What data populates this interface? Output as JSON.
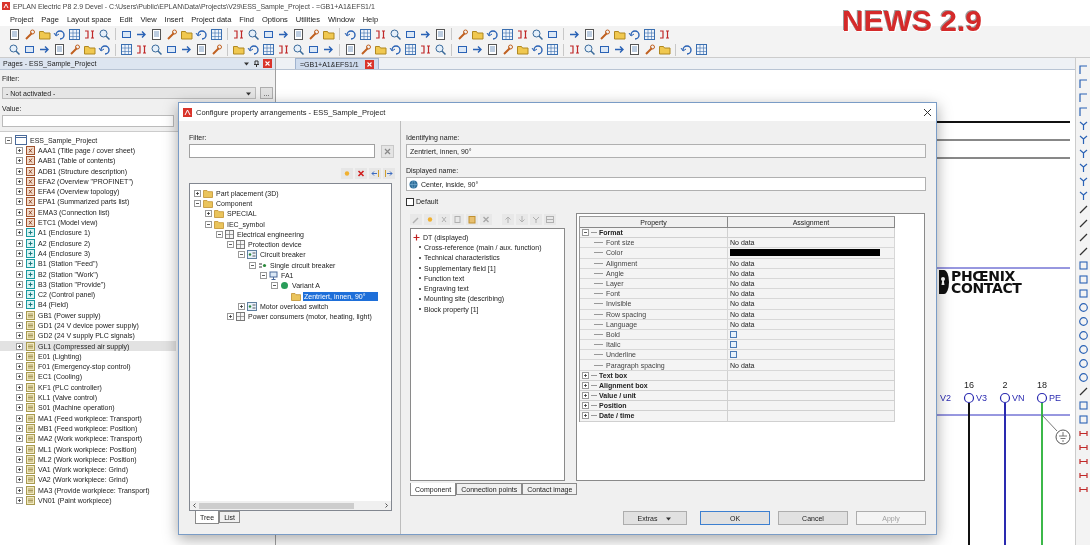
{
  "window": {
    "title": "EPLAN Electric P8 2.9 Devel - C:\\Users\\Public\\EPLAN\\Data\\Projects\\V29\\ESS_Sample_Project - =GB1+A1&EFS1/1"
  },
  "menu": [
    "Project",
    "Page",
    "Layout space",
    "Edit",
    "View",
    "Insert",
    "Project data",
    "Find",
    "Options",
    "Utilities",
    "Window",
    "Help"
  ],
  "overlay_title": "NEWS 2.9",
  "pages_panel": {
    "title": "Pages - ESS_Sample_Project",
    "filter_label": "Filter:",
    "filter_value": "- Not activated -",
    "browse_button": "...",
    "value_label": "Value:",
    "tree": {
      "label": "ESS_Sample_Project",
      "kind": "project",
      "expanded": true,
      "selected": false,
      "children": [
        {
          "label": "AAA1 (Title page / cover sheet)",
          "kind": "document",
          "expanded": false,
          "selected": false
        },
        {
          "label": "AAB1 (Table of contents)",
          "kind": "document",
          "expanded": false,
          "selected": false
        },
        {
          "label": "ADB1 (Structure description)",
          "kind": "document",
          "expanded": false,
          "selected": false
        },
        {
          "label": "EFA2 (Overview \"PROFINET\")",
          "kind": "document",
          "expanded": false,
          "selected": false
        },
        {
          "label": "EFA4 (Overview topology)",
          "kind": "document",
          "expanded": false,
          "selected": false
        },
        {
          "label": "EPA1 (Summarized parts list)",
          "kind": "document",
          "expanded": false,
          "selected": false
        },
        {
          "label": "EMA3 (Connection list)",
          "kind": "document",
          "expanded": false,
          "selected": false
        },
        {
          "label": "ETC1 (Model view)",
          "kind": "document",
          "expanded": false,
          "selected": false
        },
        {
          "label": "A1 (Enclosure 1)",
          "kind": "enclosure",
          "expanded": false,
          "selected": false
        },
        {
          "label": "A2 (Enclosure 2)",
          "kind": "enclosure",
          "expanded": false,
          "selected": false
        },
        {
          "label": "A4 (Enclosure 3)",
          "kind": "enclosure",
          "expanded": false,
          "selected": false
        },
        {
          "label": "B1 (Station \"Feed\")",
          "kind": "enclosure",
          "expanded": false,
          "selected": false
        },
        {
          "label": "B2 (Station \"Work\")",
          "kind": "enclosure",
          "expanded": false,
          "selected": false
        },
        {
          "label": "B3 (Station \"Provide\")",
          "kind": "enclosure",
          "expanded": false,
          "selected": false
        },
        {
          "label": "C2 (Control panel)",
          "kind": "enclosure",
          "expanded": false,
          "selected": false
        },
        {
          "label": "B4 (Field)",
          "kind": "enclosure",
          "expanded": false,
          "selected": false
        },
        {
          "label": "GB1 (Power supply)",
          "kind": "function",
          "expanded": false,
          "selected": false
        },
        {
          "label": "GD1 (24 V device power supply)",
          "kind": "function",
          "expanded": false,
          "selected": false
        },
        {
          "label": "GD2 (24 V supply PLC signals)",
          "kind": "function",
          "expanded": false,
          "selected": false
        },
        {
          "label": "GL1 (Compressed air supply)",
          "kind": "function",
          "expanded": false,
          "selected": true
        },
        {
          "label": "E01 (Lighting)",
          "kind": "function",
          "expanded": false,
          "selected": false
        },
        {
          "label": "F01 (Emergency-stop control)",
          "kind": "function",
          "expanded": false,
          "selected": false
        },
        {
          "label": "EC1 (Cooling)",
          "kind": "function",
          "expanded": false,
          "selected": false
        },
        {
          "label": "KF1 (PLC controller)",
          "kind": "function",
          "expanded": false,
          "selected": false
        },
        {
          "label": "KL1 (Valve control)",
          "kind": "function",
          "expanded": false,
          "selected": false
        },
        {
          "label": "S01 (Machine operation)",
          "kind": "function",
          "expanded": false,
          "selected": false
        },
        {
          "label": "MA1 (Feed workpiece: Transport)",
          "kind": "function",
          "expanded": false,
          "selected": false
        },
        {
          "label": "MB1 (Feed workpiece: Position)",
          "kind": "function",
          "expanded": false,
          "selected": false
        },
        {
          "label": "MA2 (Work workpiece: Transport)",
          "kind": "function",
          "expanded": false,
          "selected": false
        },
        {
          "label": "ML1 (Work workpiece: Position)",
          "kind": "function",
          "expanded": false,
          "selected": false
        },
        {
          "label": "ML2 (Work workpiece: Position)",
          "kind": "function",
          "expanded": false,
          "selected": false
        },
        {
          "label": "VA1 (Work workpiece: Grind)",
          "kind": "function",
          "expanded": false,
          "selected": false
        },
        {
          "label": "VA2 (Work workpiece: Grind)",
          "kind": "function",
          "expanded": false,
          "selected": false
        },
        {
          "label": "MA3 (Provide workpiece: Transport)",
          "kind": "function",
          "expanded": false,
          "selected": false
        },
        {
          "label": "VN01 (Paint workpiece)",
          "kind": "function",
          "expanded": false,
          "selected": false
        }
      ]
    }
  },
  "document_tab": {
    "label": "=GB1+A1&EFS1/1"
  },
  "schematic": {
    "logo": [
      "PHŒNIX",
      "CONTACT"
    ],
    "terminals": [
      {
        "label": "V2"
      },
      {
        "number": "16",
        "label": "V3",
        "color": "#111111"
      },
      {
        "number": "2",
        "label": "VN",
        "color": "#2a2ab0"
      },
      {
        "number": "18",
        "label": "PE",
        "color": "#3cb84a"
      }
    ]
  },
  "dialog": {
    "title": "Configure property arrangements - ESS_Sample_Project",
    "filter_label": "Filter:",
    "tree": [
      {
        "label": "Part placement (3D)",
        "kind": "folder",
        "expanded": false,
        "selected": false
      },
      {
        "label": "Component",
        "kind": "folder",
        "expanded": true,
        "selected": false,
        "children": [
          {
            "label": "SPECIAL",
            "kind": "folder",
            "expanded": false,
            "selected": false
          },
          {
            "label": "IEC_symbol",
            "kind": "folder",
            "expanded": true,
            "selected": false,
            "children": [
              {
                "label": "Electrical engineering",
                "kind": "category",
                "expanded": true,
                "selected": false,
                "children": [
                  {
                    "label": "Protection device",
                    "kind": "category",
                    "expanded": true,
                    "selected": false,
                    "children": [
                      {
                        "label": "Circuit breaker",
                        "kind": "symbol",
                        "expanded": true,
                        "selected": false,
                        "children": [
                          {
                            "label": "Single circuit breaker",
                            "kind": "contacts",
                            "expanded": true,
                            "selected": false,
                            "children": [
                              {
                                "label": "FA1",
                                "kind": "device",
                                "expanded": true,
                                "selected": false,
                                "children": [
                                  {
                                    "label": "Variant A",
                                    "kind": "variant",
                                    "expanded": true,
                                    "selected": false,
                                    "children": [
                                      {
                                        "label": "Zentriert, innen, 90°",
                                        "kind": "folder",
                                        "selected": true
                                      }
                                    ]
                                  }
                                ]
                              }
                            ]
                          }
                        ]
                      },
                      {
                        "label": "Motor overload switch",
                        "kind": "symbol",
                        "expanded": false,
                        "selected": false
                      }
                    ]
                  },
                  {
                    "label": "Power consumers (motor, heating, light)",
                    "kind": "category",
                    "expanded": false,
                    "selected": false
                  }
                ]
              }
            ]
          }
        ]
      }
    ],
    "tabs": [
      {
        "label": "Tree",
        "selected": true
      },
      {
        "label": "List",
        "selected": false
      }
    ],
    "identifying_name": {
      "label": "Identifying name:",
      "value": "Zentriert, innen, 90°"
    },
    "displayed_name": {
      "label": "Displayed name:",
      "value": "Center, inside, 90°"
    },
    "default": {
      "label": "Default",
      "checked": false
    },
    "arrangement_list": [
      {
        "label": "DT (displayed)",
        "kind": "main"
      },
      {
        "label": "Cross-reference (main / aux. function)",
        "kind": "item"
      },
      {
        "label": "Technical characteristics",
        "kind": "item"
      },
      {
        "label": "Supplementary field [1]",
        "kind": "item"
      },
      {
        "label": "Function text",
        "kind": "item"
      },
      {
        "label": "Engraving text",
        "kind": "item"
      },
      {
        "label": "Mounting site (describing)",
        "kind": "item"
      },
      {
        "label": "Block property [1]",
        "kind": "item"
      }
    ],
    "list_tabs": [
      {
        "label": "Component",
        "selected": true
      },
      {
        "label": "Connection points",
        "selected": false
      },
      {
        "label": "Contact image",
        "selected": false
      }
    ],
    "property_grid": {
      "columns": [
        "Property",
        "Assignment"
      ],
      "groups": [
        {
          "label": "Format",
          "expanded": true,
          "rows": [
            {
              "property": "Font size",
              "kind": "text",
              "value": "No data"
            },
            {
              "property": "Color",
              "kind": "color",
              "color": "#000000"
            },
            {
              "property": "Alignment",
              "kind": "text",
              "value": "No data"
            },
            {
              "property": "Angle",
              "kind": "text",
              "value": "No data"
            },
            {
              "property": "Layer",
              "kind": "text",
              "value": "No data"
            },
            {
              "property": "Font",
              "kind": "text",
              "value": "No data"
            },
            {
              "property": "Invisible",
              "kind": "text",
              "value": "No data"
            },
            {
              "property": "Row spacing",
              "kind": "text",
              "value": "No data"
            },
            {
              "property": "Language",
              "kind": "text",
              "value": "No data"
            },
            {
              "property": "Bold",
              "kind": "checkbox",
              "checked": false
            },
            {
              "property": "Italic",
              "kind": "checkbox",
              "checked": false
            },
            {
              "property": "Underline",
              "kind": "checkbox",
              "checked": false
            },
            {
              "property": "Paragraph spacing",
              "kind": "text",
              "value": "No data"
            }
          ]
        },
        {
          "label": "Text box",
          "expanded": false
        },
        {
          "label": "Alignment box",
          "expanded": false
        },
        {
          "label": "Value / unit",
          "expanded": false
        },
        {
          "label": "Position",
          "expanded": false
        },
        {
          "label": "Date / time",
          "expanded": false
        }
      ]
    },
    "buttons": [
      {
        "label": "Extras",
        "kind": "menu",
        "default": false,
        "disabled": false
      },
      {
        "label": "OK",
        "kind": "plain",
        "default": true,
        "disabled": false
      },
      {
        "label": "Cancel",
        "kind": "plain",
        "default": false,
        "disabled": false
      },
      {
        "label": "Apply",
        "kind": "plain",
        "default": false,
        "disabled": true
      }
    ]
  }
}
